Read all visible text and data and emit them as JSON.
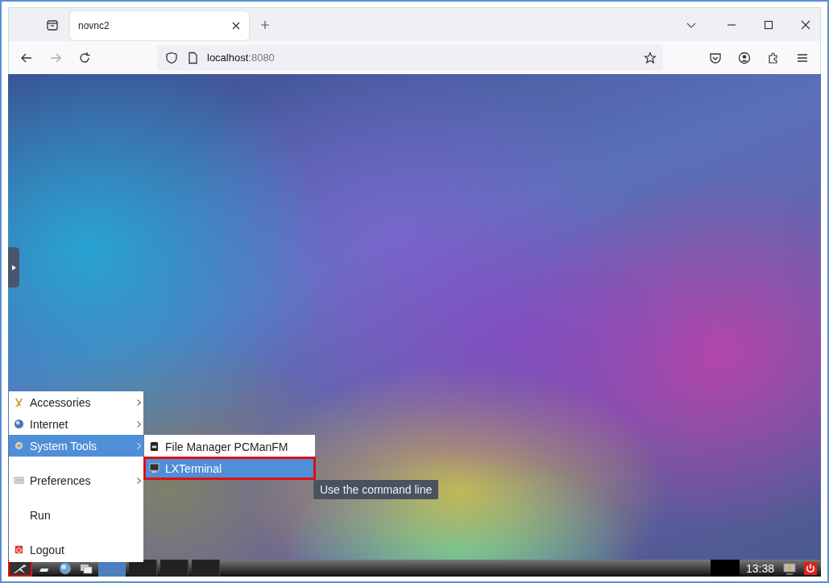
{
  "browser": {
    "tab_title": "novnc2",
    "url_host": "localhost",
    "url_port": ":8080"
  },
  "edge_panel": {
    "expanded": false
  },
  "menu": {
    "items": [
      {
        "kind": "submenu",
        "label": "Accessories",
        "selected": false
      },
      {
        "kind": "submenu",
        "label": "Internet",
        "selected": false
      },
      {
        "kind": "submenu",
        "label": "System Tools",
        "selected": true
      },
      {
        "kind": "separator"
      },
      {
        "kind": "submenu",
        "label": "Preferences",
        "selected": false
      },
      {
        "kind": "separator"
      },
      {
        "kind": "action",
        "label": "Run",
        "selected": false
      },
      {
        "kind": "separator"
      },
      {
        "kind": "action",
        "label": "Logout",
        "selected": false
      }
    ]
  },
  "submenu": {
    "items": [
      {
        "label": "File Manager PCManFM",
        "selected": false,
        "highlighted": false
      },
      {
        "label": "LXTerminal",
        "selected": true,
        "highlighted": true
      }
    ]
  },
  "tooltip": "Use the command line",
  "taskbar": {
    "start_highlighted": true,
    "clock": "13:38"
  }
}
